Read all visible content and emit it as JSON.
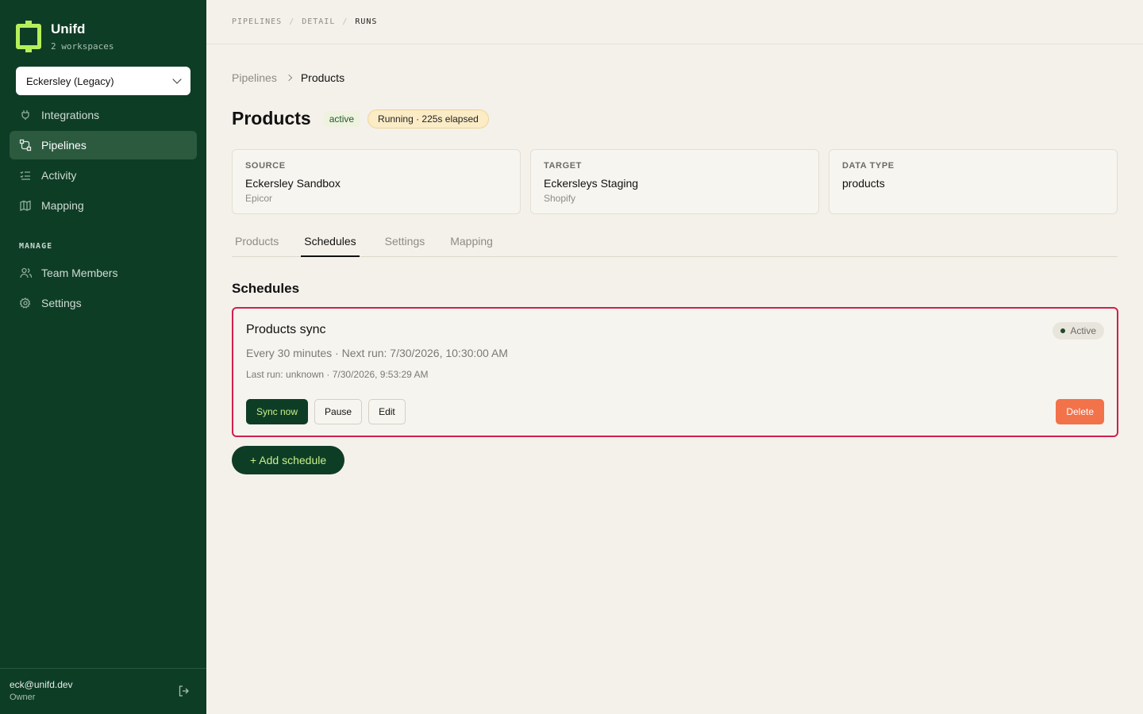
{
  "app": {
    "name": "Unifd",
    "workspaces_label": "2 workspaces",
    "workspace": "Eckersley (Legacy)"
  },
  "sidebar": {
    "items": [
      {
        "label": "Integrations",
        "icon": "plug-icon"
      },
      {
        "label": "Pipelines",
        "icon": "pipeline-icon",
        "active": true
      },
      {
        "label": "Activity",
        "icon": "list-check-icon"
      },
      {
        "label": "Mapping",
        "icon": "map-icon"
      }
    ],
    "manage_label": "MANAGE",
    "manage_items": [
      {
        "label": "Team Members",
        "icon": "users-icon"
      },
      {
        "label": "Settings",
        "icon": "gear-icon"
      }
    ],
    "user": {
      "email": "eck@unifd.dev",
      "role": "Owner"
    }
  },
  "topbar": {
    "crumbs": [
      "PIPELINES",
      "DETAIL",
      "RUNS"
    ]
  },
  "page": {
    "crumbs": [
      "Pipelines",
      "Products"
    ],
    "title": "Products",
    "status_badge": "active",
    "running_badge": "Running · 225s elapsed",
    "cards": [
      {
        "label": "SOURCE",
        "value": "Eckersley Sandbox",
        "sub": "Epicor"
      },
      {
        "label": "TARGET",
        "value": "Eckersleys Staging",
        "sub": "Shopify"
      },
      {
        "label": "DATA TYPE",
        "value": "products",
        "sub": ""
      }
    ],
    "tabs": [
      "Products",
      "Schedules",
      "Settings",
      "Mapping"
    ],
    "active_tab": "Schedules",
    "section_title": "Schedules"
  },
  "schedule": {
    "name": "Products sync",
    "line1": "Every 30 minutes · Next run: 7/30/2026, 10:30:00 AM",
    "line2": "Last run: unknown · 7/30/2026, 9:53:29 AM",
    "status": "Active",
    "sync_label": "Sync now",
    "pause_label": "Pause",
    "edit_label": "Edit",
    "delete_label": "Delete"
  },
  "add_schedule_label": "+ Add schedule",
  "colors": {
    "sidebar_bg": "#0e3d26",
    "accent_lime": "#b5f05b",
    "highlight_border": "#d0204f",
    "danger": "#f2724a"
  }
}
